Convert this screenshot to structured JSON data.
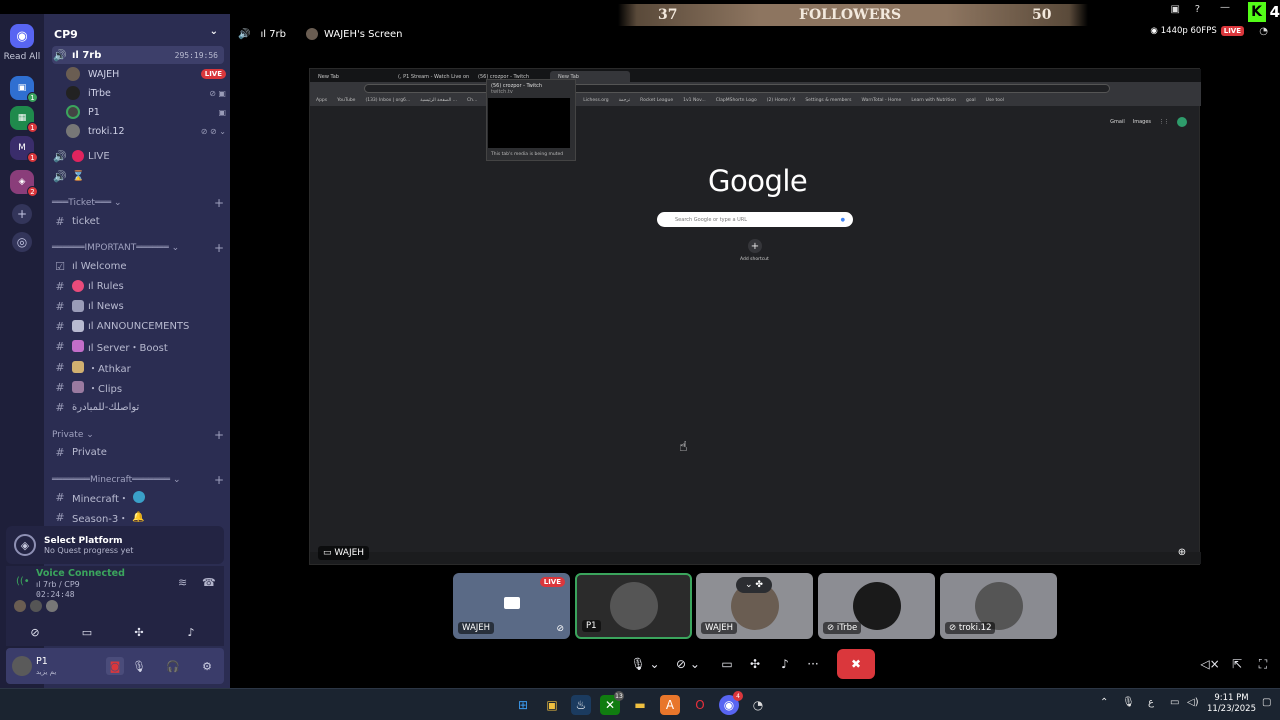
{
  "rail": {
    "read_all": "Read All",
    "badges": [
      "1",
      "1",
      "2"
    ]
  },
  "server": {
    "name": "CP9"
  },
  "voice_channel": {
    "name": "ıl 7rb",
    "duration": "295:19:56"
  },
  "members": [
    {
      "name": "WAJEH",
      "live": "LIVE"
    },
    {
      "name": "iTrbe"
    },
    {
      "name": "P1"
    },
    {
      "name": "troki.12"
    }
  ],
  "channels_top": [
    {
      "label": "LIVE"
    },
    {
      "label": "⌛"
    }
  ],
  "categories": {
    "ticket": "Ticket",
    "important": "IMPORTANT",
    "private": "Private",
    "minecraft": "Minecraft"
  },
  "ticket_channels": [
    "ticket"
  ],
  "important_channels": [
    {
      "label": "ıl Welcome",
      "color": "#8a8cb0"
    },
    {
      "label": "ıl Rules",
      "color": "#e94b7b"
    },
    {
      "label": "ıl News",
      "color": "#9a9cb8"
    },
    {
      "label": "ıl ANNOUNCEMENTS",
      "color": "#b8bad0"
    },
    {
      "label": "ıl Server・Boost",
      "color": "#c36ec9"
    },
    {
      "label": "・Athkar",
      "color": "#d1b070"
    },
    {
      "label": "・Clips",
      "color": "#9a7aa0"
    },
    {
      "label": "تواصلك-للمبادرة",
      "color": "#9a9cb8"
    }
  ],
  "private_channels": [
    "Private"
  ],
  "minecraft_channels": [
    "Minecraft・",
    "Season-3・"
  ],
  "quest": {
    "title": "Select Platform",
    "subtitle": "No Quest progress yet"
  },
  "voice": {
    "status": "Voice Connected",
    "location": "ıl 7rb / CP9",
    "elapsed": "02:24:48"
  },
  "account": {
    "name": "P1",
    "status": "يم يزيد"
  },
  "stage": {
    "channel_title": "ıl 7rb",
    "screen_title": "WAJEH's Screen",
    "followers_count": "37",
    "followers_label": "FOLLOWERS",
    "followers_goal": "50",
    "quality": "1440p 60FPS",
    "live": "LIVE",
    "kick_count": "4",
    "stream_tag": "WAJEH"
  },
  "browser": {
    "tabs": [
      "New Tab",
      "(, P1 Stream - Watch Live on K",
      "(56) crozpor - Twitch",
      "New Tab"
    ],
    "bookmarks": [
      "Apps",
      "YouTube",
      "(133) Inbox | org6...",
      "الصفحة الرئيسية ...",
      "Ch...",
      "Telegram Web",
      "MAAA Stream Links",
      "Lichess.org",
      "ترجمة",
      "Rocket League",
      "1v1 Nov...",
      "ClapMShortn Logo",
      "(2) Home / X",
      "Settings & members",
      "WarnTotal - Home",
      "Learn with Nutrition",
      "goal",
      "Use tool"
    ],
    "preview_title": "(56) crozpor - Twitch",
    "preview_sub": "twitch.tv",
    "preview_foot": "This tab's media is being muted",
    "google": "Google",
    "search_placeholder": "Search Google or type a URL",
    "shortcut_label": "Add shortcut",
    "links": [
      "Gmail",
      "Images"
    ]
  },
  "tiles": [
    {
      "name": "WAJEH",
      "live": "LIVE",
      "bg": "#5a6a86"
    },
    {
      "name": "P1",
      "bg": "#3a3a3a"
    },
    {
      "name": "WAJEH",
      "bg": "#8e8f94"
    },
    {
      "name": "iTrbe",
      "bg": "#8c8d93"
    },
    {
      "name": "troki.12",
      "bg": "#8a8b91"
    }
  ],
  "taskbar": {
    "time": "9:11 PM",
    "date": "11/23/2025",
    "lang": "ع",
    "badge_steam": "13",
    "badge_discord": "4"
  },
  "colors": {
    "blurple": "#5865f2",
    "live": "#da373c",
    "green": "#3ba55d",
    "kick": "#53fc18"
  }
}
